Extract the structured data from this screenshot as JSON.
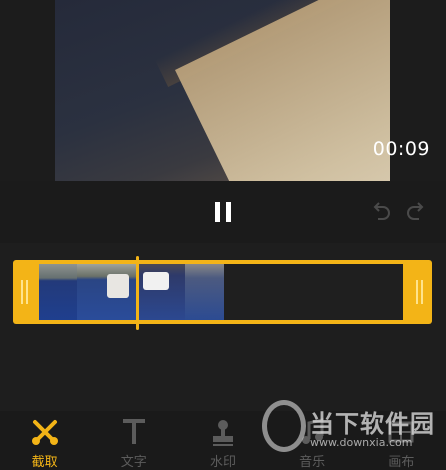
{
  "preview": {
    "time": "00:09"
  },
  "controls": {
    "pause_icon": "pause-icon",
    "undo_icon": "undo-icon",
    "redo_icon": "redo-icon"
  },
  "timeline": {
    "playhead_fraction": 0.31
  },
  "tabs": [
    {
      "label": "截取",
      "icon": "scissors-icon",
      "active": true
    },
    {
      "label": "文字",
      "icon": "text-icon",
      "active": false
    },
    {
      "label": "水印",
      "icon": "stamp-icon",
      "active": false
    },
    {
      "label": "音乐",
      "icon": "music-icon",
      "active": false
    },
    {
      "label": "画布",
      "icon": "canvas-icon",
      "active": false
    }
  ],
  "watermark": {
    "brand": "当下软件园",
    "url": "www.downxia.com"
  },
  "colors": {
    "accent": "#f3b417",
    "background": "#1a1a1a",
    "inactive": "#5c5c5c"
  }
}
